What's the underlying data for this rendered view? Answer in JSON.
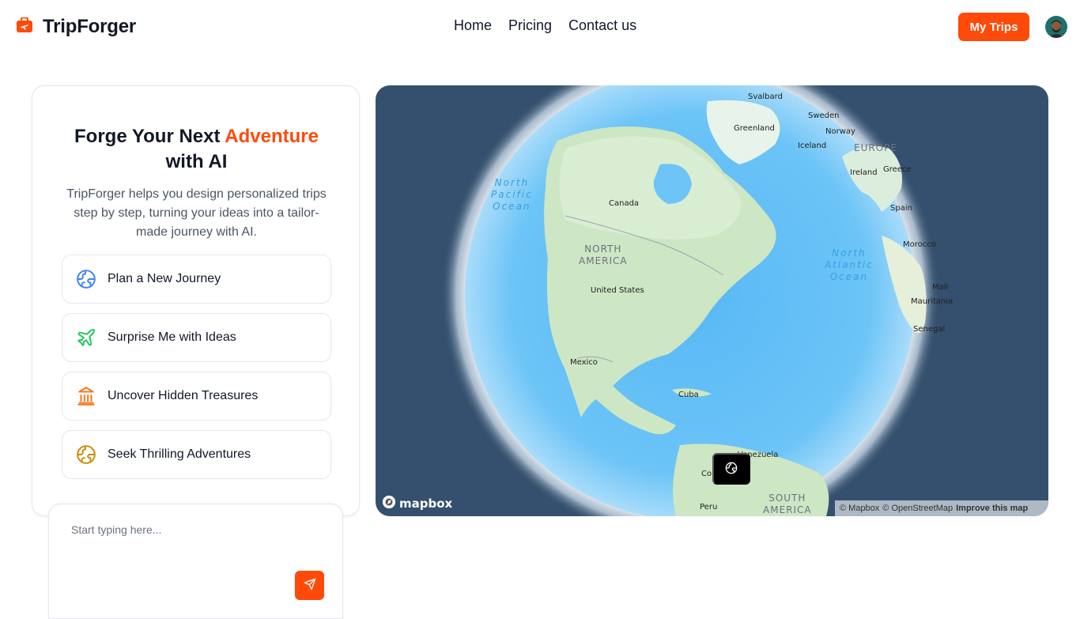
{
  "header": {
    "brand": "TripForger",
    "nav": [
      "Home",
      "Pricing",
      "Contact us"
    ],
    "my_trips": "My Trips",
    "colors": {
      "accent": "#ff4a0a"
    }
  },
  "hero": {
    "title_part1": "Forge Your Next ",
    "title_accent": "Adventure",
    "title_part2": "with AI",
    "description": "TripForger helps you design personalized trips step by step, turning your ideas into a tailor-made journey with AI."
  },
  "options": [
    {
      "label": "Plan a New Journey",
      "icon": "globe-icon",
      "color": "#3b82f6"
    },
    {
      "label": "Surprise Me with Ideas",
      "icon": "plane-icon",
      "color": "#22c55e"
    },
    {
      "label": "Uncover Hidden Treasures",
      "icon": "landmark-icon",
      "color": "#f97316"
    },
    {
      "label": "Seek Thrilling Adventures",
      "icon": "globe-icon",
      "color": "#ca8a04"
    }
  ],
  "composer": {
    "placeholder": "Start typing here...",
    "send_icon": "send-icon"
  },
  "map": {
    "labels": {
      "svalbard": "Svalbard",
      "sweden": "Sweden",
      "greenland": "Greenland",
      "norway": "Norway",
      "iceland": "Iceland",
      "europe": "EUROPE",
      "ireland": "Ireland",
      "greece": "Greece",
      "canada": "Canada",
      "spain": "Spain",
      "morocco": "Morocco",
      "north_america_1": "NORTH",
      "north_america_2": "AMERICA",
      "united_states": "United States",
      "mali": "Mali",
      "mauritania": "Mauritania",
      "senegal": "Senegal",
      "mexico": "Mexico",
      "cuba": "Cuba",
      "venezuela": "Venezuela",
      "colombia": "Co",
      "peru": "Peru",
      "south_america_1": "SOUTH",
      "south_america_2": "AMERICA",
      "pacific_1": "North",
      "pacific_2": "Pacific",
      "pacific_3": "Ocean",
      "atlantic_1": "North",
      "atlantic_2": "Atlantic",
      "atlantic_3": "Ocean"
    },
    "logo": "mapbox",
    "attribution_mapbox": "© Mapbox",
    "attribution_osm": "© OpenStreetMap",
    "improve": "Improve this map"
  }
}
